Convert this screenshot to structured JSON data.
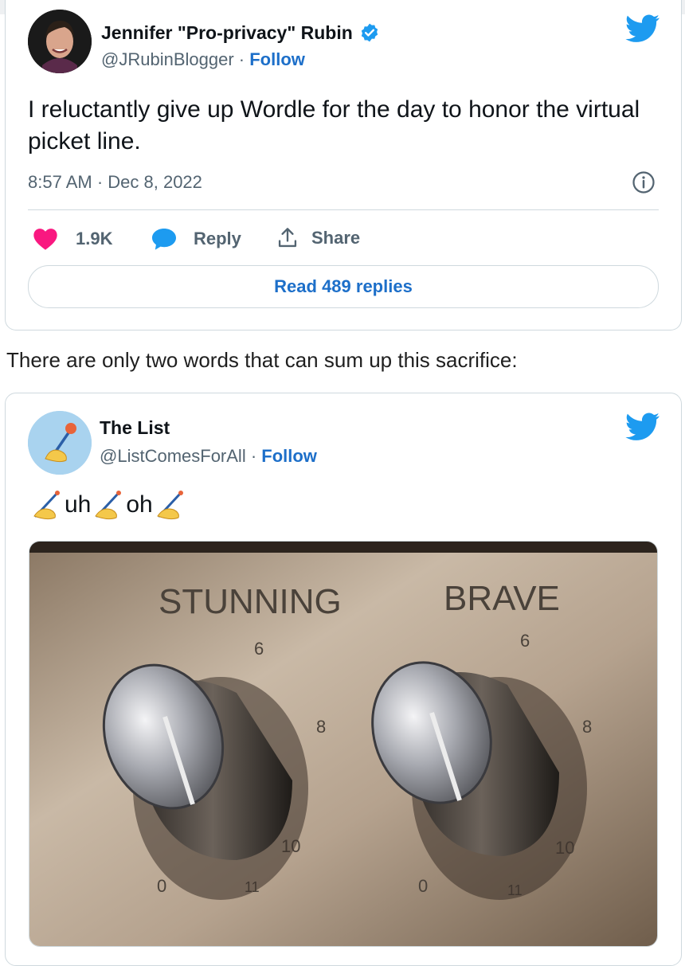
{
  "tweet1": {
    "display_name": "Jennifer \"Pro-privacy\" Rubin",
    "handle": "@JRubinBlogger",
    "separator": " · ",
    "follow_label": "Follow",
    "text": "I reluctantly give up Wordle for the day to honor the virtual picket line.",
    "timestamp": "8:57 AM · Dec 8, 2022",
    "like_count": "1.9K",
    "reply_label": "Reply",
    "share_label": "Share",
    "read_replies_label": "Read 489 replies"
  },
  "article_text": "There are only two words that can sum up this sacrifice:",
  "tweet2": {
    "display_name": "The List",
    "handle": "@ListComesForAll",
    "separator": " · ",
    "follow_label": "Follow",
    "text_parts": [
      "uh",
      "oh"
    ],
    "image": {
      "left_label": "STUNNING",
      "right_label": "BRAVE",
      "dial_numbers": [
        "6",
        "8",
        "10",
        "0",
        "11"
      ]
    }
  },
  "colors": {
    "twitter_blue": "#1d9bf0",
    "link_blue": "#1d6fc9",
    "like_pink": "#f91880",
    "muted": "#536471",
    "border": "#cfd9de"
  },
  "icons": {
    "twitter": "twitter-bird-icon",
    "verified": "verified-badge-icon",
    "info": "info-icon",
    "like": "heart-icon",
    "reply": "speech-bubble-icon",
    "share": "share-upload-icon",
    "writing_hand": "writing-hand-emoji"
  }
}
